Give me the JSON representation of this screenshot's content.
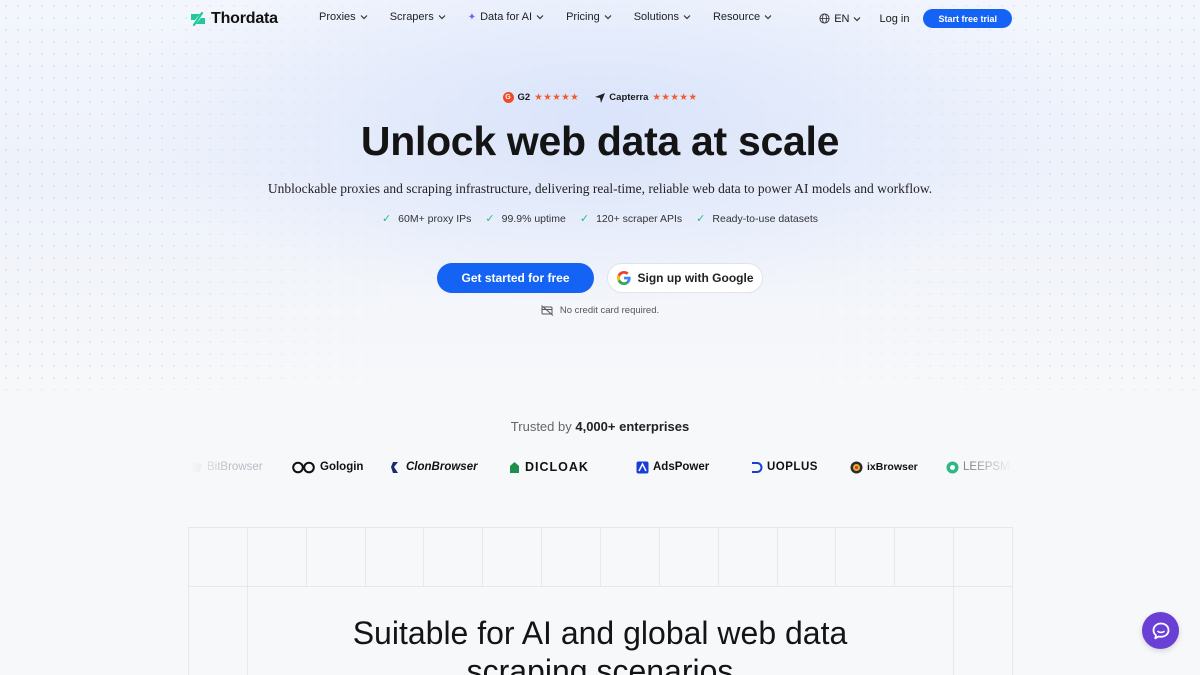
{
  "nav": {
    "brand": "Thordata",
    "menu": [
      {
        "label": "Proxies"
      },
      {
        "label": "Scrapers"
      },
      {
        "label": "Data for AI"
      },
      {
        "label": "Pricing"
      },
      {
        "label": "Solutions"
      },
      {
        "label": "Resource"
      }
    ],
    "language": "EN",
    "login": "Log in",
    "trial_button": "Start free trial"
  },
  "ratings": [
    {
      "source": "G2",
      "stars": "★★★★★",
      "score": 4.5
    },
    {
      "source": "Capterra",
      "stars": "★★★★★",
      "score": 4.5
    }
  ],
  "hero": {
    "title": "Unlock web data at scale",
    "subtitle": "Unblockable proxies and scraping infrastructure, delivering real-time, reliable web data to power AI models and workflow.",
    "features": [
      "60M+ proxy IPs",
      "99.9% uptime",
      "120+ scraper APIs",
      "Ready-to-use datasets"
    ],
    "primary_cta": "Get started for free",
    "google_cta": "Sign up with Google",
    "no_card": "No credit card required."
  },
  "trusted": {
    "prefix": "Trusted by",
    "count": "4,000+ enterprises",
    "brands": [
      "BitBrowser",
      "Gologin",
      "ClonBrowser",
      "DICLOAK",
      "AdsPower",
      "UOPLUS",
      "ixBrowser",
      "LEEPSMA"
    ]
  },
  "section": {
    "title_line1": "Suitable for AI and global web data",
    "title_line2": "scraping scenarios"
  },
  "colors": {
    "primary": "#1463f5",
    "check": "#2db886",
    "star": "#f25c2a",
    "chat": "#6a3fd6"
  }
}
